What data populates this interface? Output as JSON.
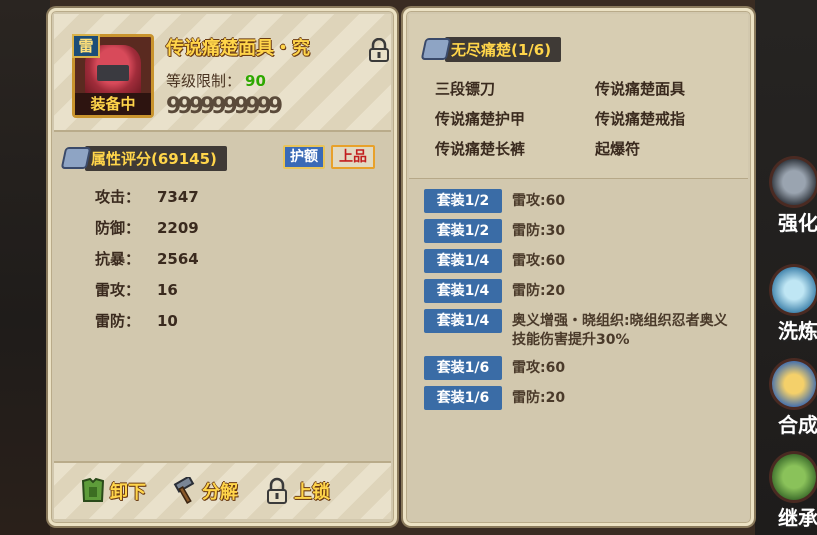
{
  "item": {
    "element_badge": "雷",
    "status_label": "装备中",
    "name": "传说痛楚面具・究",
    "level_label": "等级限制：",
    "level_value": "90",
    "upgrade_slots": "9999999999"
  },
  "stats": {
    "rating_label": "属性评分(69145)",
    "tag_guard": "护额",
    "tag_grade": "上品",
    "rows": [
      {
        "key": "攻击：",
        "value": "7347"
      },
      {
        "key": "防御：",
        "value": "2209"
      },
      {
        "key": "抗暴：",
        "value": "2564"
      },
      {
        "key": "雷攻：",
        "value": "16"
      },
      {
        "key": "雷防：",
        "value": "10"
      }
    ]
  },
  "actions": {
    "unequip": "卸下",
    "decompose": "分解",
    "lock": "上锁"
  },
  "set": {
    "title": "无尽痛楚(1/6)",
    "parts": [
      "三段镖刀",
      "传说痛楚面具",
      "传说痛楚护甲",
      "传说痛楚戒指",
      "传说痛楚长裤",
      "起爆符"
    ],
    "bonuses": [
      {
        "tag": "套装1/2",
        "text": "雷攻:60"
      },
      {
        "tag": "套装1/2",
        "text": "雷防:30"
      },
      {
        "tag": "套装1/4",
        "text": "雷攻:60"
      },
      {
        "tag": "套装1/4",
        "text": "雷防:20"
      },
      {
        "tag": "套装1/4",
        "text": "奥义增强・晓组织:晓组织忍者奥义技能伤害提升30%"
      },
      {
        "tag": "套装1/6",
        "text": "雷攻:60"
      },
      {
        "tag": "套装1/6",
        "text": "雷防:20"
      }
    ]
  },
  "side_buttons": [
    "强化",
    "洗炼",
    "合成",
    "继承"
  ],
  "icons": {
    "lock": "padlock-icon",
    "unequip": "armor-icon",
    "decompose": "hammer-icon",
    "gem": "scroll-gem-icon"
  }
}
